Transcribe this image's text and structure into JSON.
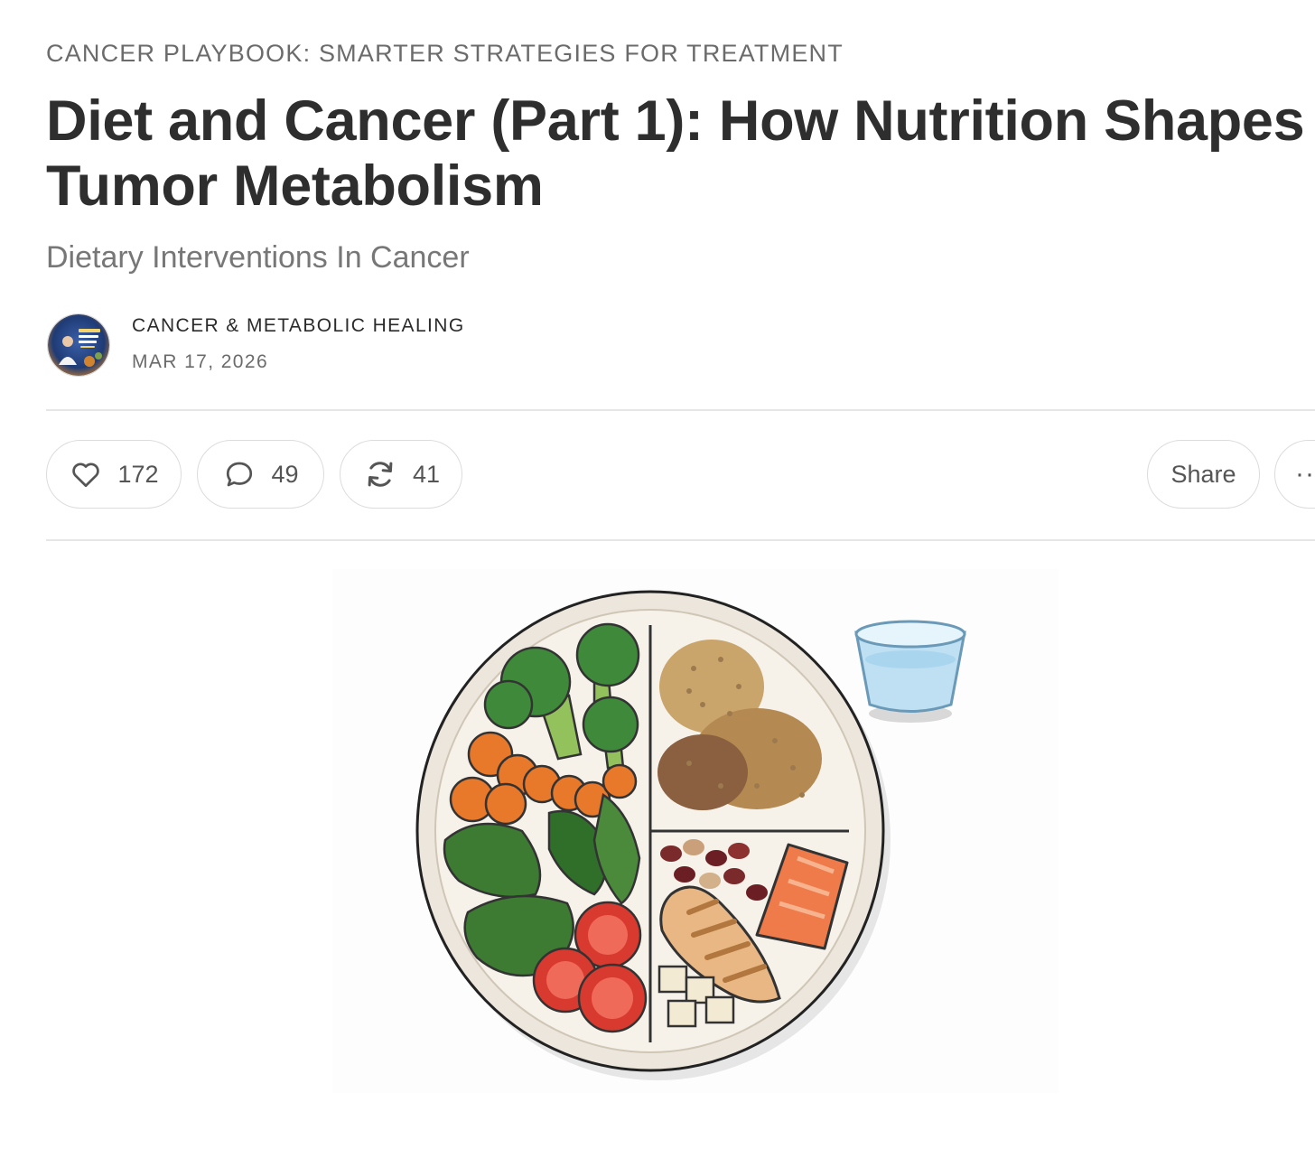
{
  "post": {
    "section_label": "CANCER PLAYBOOK: SMARTER STRATEGIES FOR TREATMENT",
    "title": "Diet and Cancer (Part 1): How Nutrition Shapes Tumor Metabolism",
    "subtitle": "Dietary Interventions In Cancer",
    "author": "CANCER & METABOLIC HEALING",
    "date": "MAR 17, 2026"
  },
  "actions": {
    "like": {
      "icon": "heart-icon",
      "count": "172"
    },
    "comment": {
      "icon": "comment-icon",
      "count": "49"
    },
    "restack": {
      "icon": "restack-icon",
      "count": "41"
    },
    "share_label": "Share",
    "more_label": "··"
  },
  "hero_image": {
    "description_icon": "healthy-plate-illustration",
    "colors": {
      "plate_rim": "#ece6dc",
      "plate_center": "#f6f2ea",
      "broccoli": "#3f8a3a",
      "carrot": "#e8782a",
      "tomato": "#d93a2f",
      "salmon": "#ef7a4a",
      "chicken": "#e9b784",
      "glass": "#bfe0f3"
    }
  }
}
